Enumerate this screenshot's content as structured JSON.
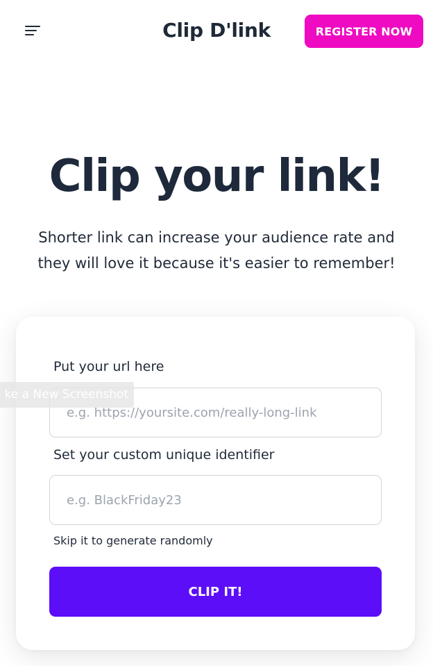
{
  "header": {
    "brand": "Clip D'link",
    "register_label": "REGISTER NOW",
    "menu_icon": "hamburger-menu-icon"
  },
  "hero": {
    "title": "Clip your link!",
    "subtitle": "Shorter link can increase your audience rate and they will love it because it's easier to remember!"
  },
  "form": {
    "url_label": "Put your url here",
    "url_placeholder": "e.g. https://yoursite.com/really-long-link",
    "url_value": "",
    "identifier_label": "Set your custom unique identifier",
    "identifier_placeholder": "e.g. BlackFriday23",
    "identifier_value": "",
    "hint": "Skip it to generate randomly",
    "submit_label": "CLIP IT!"
  },
  "overlay": {
    "label": "ke a New Screenshot"
  },
  "colors": {
    "register_button": "#ee0bc1",
    "submit_button": "#5b0ef7",
    "text_dark": "#1e293b"
  }
}
